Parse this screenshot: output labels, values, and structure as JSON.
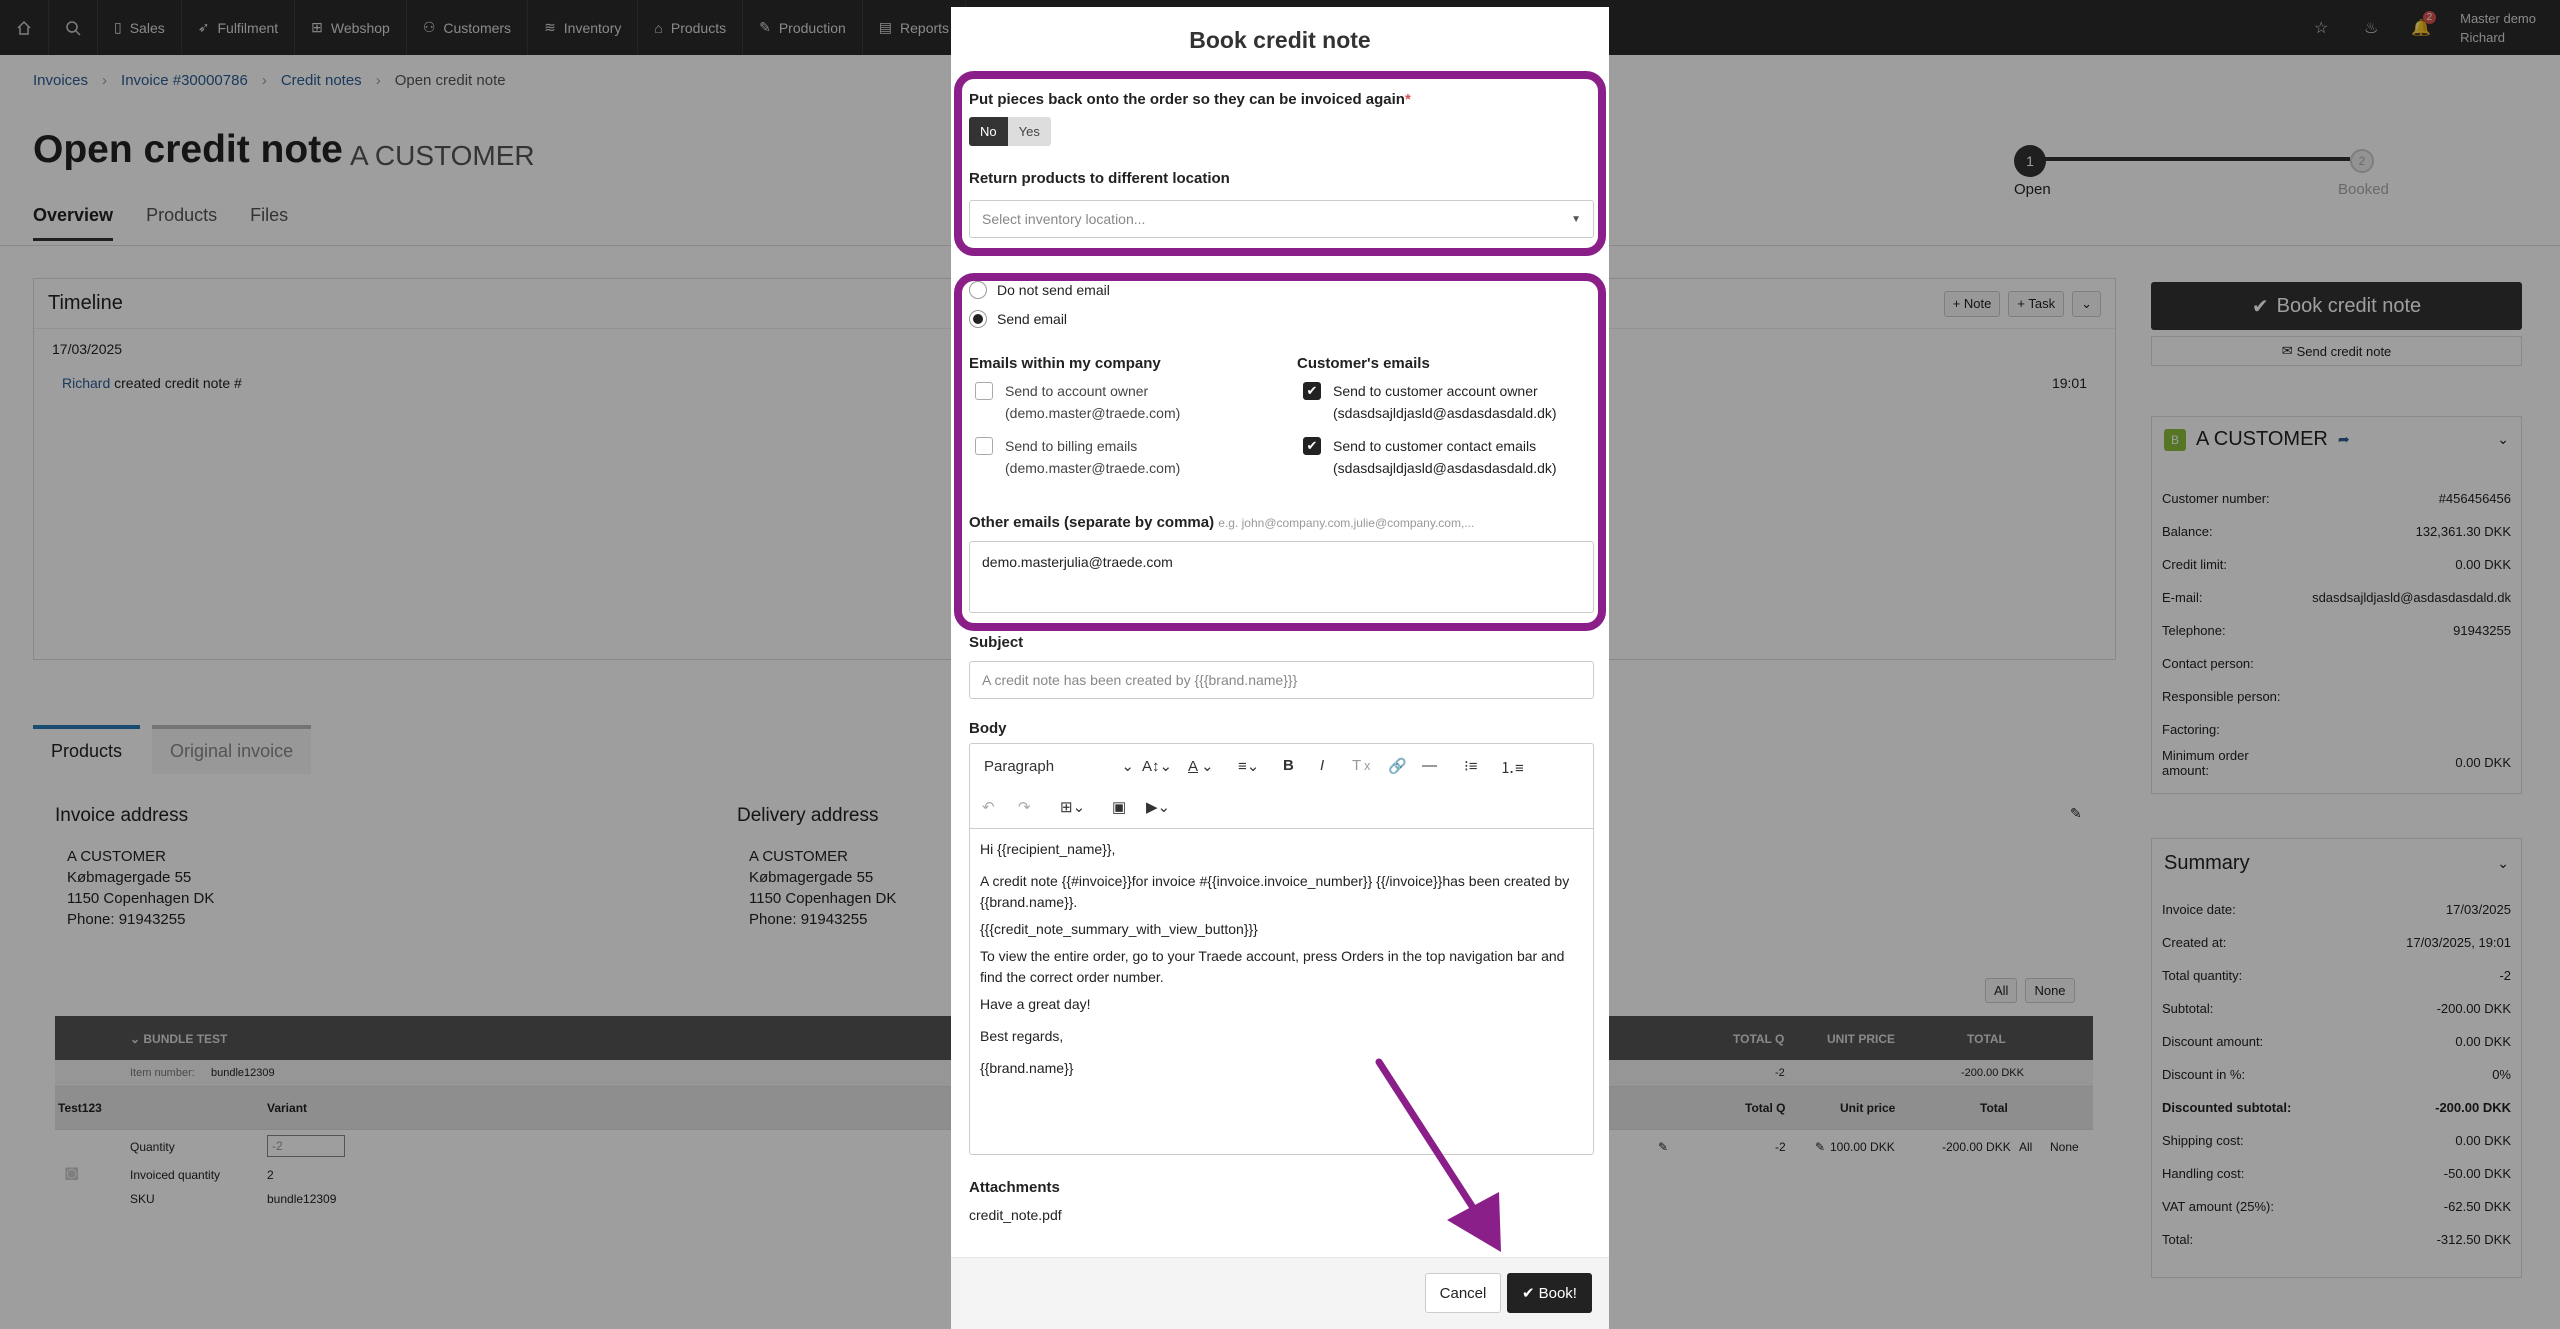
{
  "nav": {
    "items": [
      "Sales",
      "Fulfilment",
      "Webshop",
      "Customers",
      "Inventory",
      "Products",
      "Production",
      "Reports"
    ],
    "notifications_count": "2",
    "user_line1": "Master demo",
    "user_line2": "Richard"
  },
  "breadcrumb": [
    "Invoices",
    "Invoice #30000786",
    "Credit notes",
    "Open credit note"
  ],
  "page": {
    "title": "Open credit note",
    "subtitle": "A CUSTOMER",
    "tabs": [
      "Overview",
      "Products",
      "Files"
    ]
  },
  "stepper": {
    "step1_num": "1",
    "step1_label": "Open",
    "step2_num": "2",
    "step2_label": "Booked"
  },
  "timeline": {
    "title": "Timeline",
    "note_btn": "Note",
    "task_btn": "Task",
    "date": "17/03/2025",
    "entry_user": "Richard",
    "entry_text": "created credit note #",
    "entry_time": "19:01"
  },
  "product_tabs": [
    "Products",
    "Original invoice"
  ],
  "invoice_address": {
    "heading": "Invoice address",
    "lines": [
      "A CUSTOMER",
      "Købmagergade 55",
      "1150 Copenhagen DK",
      "Phone: 91943255"
    ]
  },
  "delivery_address": {
    "heading": "Delivery address",
    "lines": [
      "A CUSTOMER",
      "Købmagergade 55",
      "1150 Copenhagen DK",
      "Phone: 91943255"
    ]
  },
  "grid": {
    "all": "All",
    "none": "None",
    "bundle": "BUNDLE TEST",
    "col_total_q": "TOTAL Q",
    "col_unit_price": "UNIT PRICE",
    "col_total": "TOTAL",
    "item_number_label": "Item number:",
    "item_number": "bundle12309",
    "bundle_total_q": "-2",
    "bundle_total": "-200.00 DKK",
    "sub_name": "Test123",
    "sub_variant": "Variant",
    "sub_total_q": "Total Q",
    "sub_unit_price": "Unit price",
    "sub_total": "Total",
    "qty_label": "Quantity",
    "qty_value": "-2",
    "invoiced_label": "Invoiced quantity",
    "invoiced_value": "2",
    "sku_label": "SKU",
    "sku_value": "bundle12309",
    "line_total_q": "-2",
    "line_unit_price": "100.00 DKK",
    "line_total": "-200.00 DKK"
  },
  "side": {
    "book_btn": "Book credit note",
    "send_btn": "Send credit note",
    "customer_badge": "B",
    "customer_name": "A CUSTOMER",
    "customer_rows": [
      {
        "k": "Customer number:",
        "v": "#456456456"
      },
      {
        "k": "Balance:",
        "v": "132,361.30 DKK"
      },
      {
        "k": "Credit limit:",
        "v": "0.00 DKK"
      },
      {
        "k": "E-mail:",
        "v": "sdasdsajldjasld@asdasdasdald.dk"
      },
      {
        "k": "Telephone:",
        "v": "91943255"
      },
      {
        "k": "Contact person:",
        "v": ""
      },
      {
        "k": "Responsible person:",
        "v": ""
      },
      {
        "k": "Factoring:",
        "v": ""
      },
      {
        "k": "Minimum order amount:",
        "v": "0.00 DKK"
      }
    ],
    "summary_title": "Summary",
    "summary_rows": [
      {
        "k": "Invoice date:",
        "v": "17/03/2025"
      },
      {
        "k": "Created at:",
        "v": "17/03/2025, 19:01"
      },
      {
        "k": "Total quantity:",
        "v": "-2"
      },
      {
        "k": "Subtotal:",
        "v": "-200.00 DKK"
      },
      {
        "k": "Discount amount:",
        "v": "0.00 DKK"
      },
      {
        "k": "Discount in %:",
        "v": "0%"
      },
      {
        "k": "Discounted subtotal:",
        "v": "-200.00 DKK"
      },
      {
        "k": "Shipping cost:",
        "v": "0.00 DKK"
      },
      {
        "k": "Handling cost:",
        "v": "-50.00 DKK"
      },
      {
        "k": "VAT amount (25%):",
        "v": "-62.50 DKK"
      },
      {
        "k": "Total:",
        "v": "-312.50 DKK"
      }
    ]
  },
  "modal": {
    "title": "Book credit note",
    "put_back_label": "Put pieces back onto the order so they can be invoiced again",
    "toggle_no": "No",
    "toggle_yes": "Yes",
    "return_label": "Return products to different location",
    "location_placeholder": "Select inventory location...",
    "radio_no_email": "Do not send email",
    "radio_send_email": "Send email",
    "company_heading": "Emails within my company",
    "customer_heading": "Customer's emails",
    "cb_account_owner": "Send to account owner",
    "cb_account_owner_email": "(demo.master@traede.com)",
    "cb_billing": "Send to billing emails",
    "cb_billing_email": "(demo.master@traede.com)",
    "cb_cust_owner": "Send to customer account owner",
    "cb_cust_owner_email": "(sdasdsajldjasld@asdasdasdald.dk)",
    "cb_cust_contact": "Send to customer contact emails",
    "cb_cust_contact_email": "(sdasdsajldjasld@asdasdasdald.dk)",
    "other_label": "Other emails (separate by comma)",
    "other_hint": "e.g. john@company.com,julie@company.com,...",
    "other_value": "demo.masterjulia@traede.com",
    "subject_label": "Subject",
    "subject_placeholder": "A credit note has been created by {{{brand.name}}}",
    "body_label": "Body",
    "paragraph_select": "Paragraph",
    "body_lines": [
      "Hi {{recipient_name}},",
      "A credit note {{#invoice}}for invoice #{{invoice.invoice_number}} {{/invoice}}has been created by {{brand.name}}.",
      "{{{credit_note_summary_with_view_button}}}",
      "To view the entire order, go to your Traede account, press Orders in the top navigation bar and find the correct order number.",
      "Have a great day!",
      "Best regards,",
      "{{brand.name}}"
    ],
    "attachments_label": "Attachments",
    "attachment_file": "credit_note.pdf",
    "cancel": "Cancel",
    "book": "Book!"
  },
  "colors": {
    "highlight": "#8a1f8a",
    "dark": "#222222",
    "link": "#2a5d94"
  }
}
